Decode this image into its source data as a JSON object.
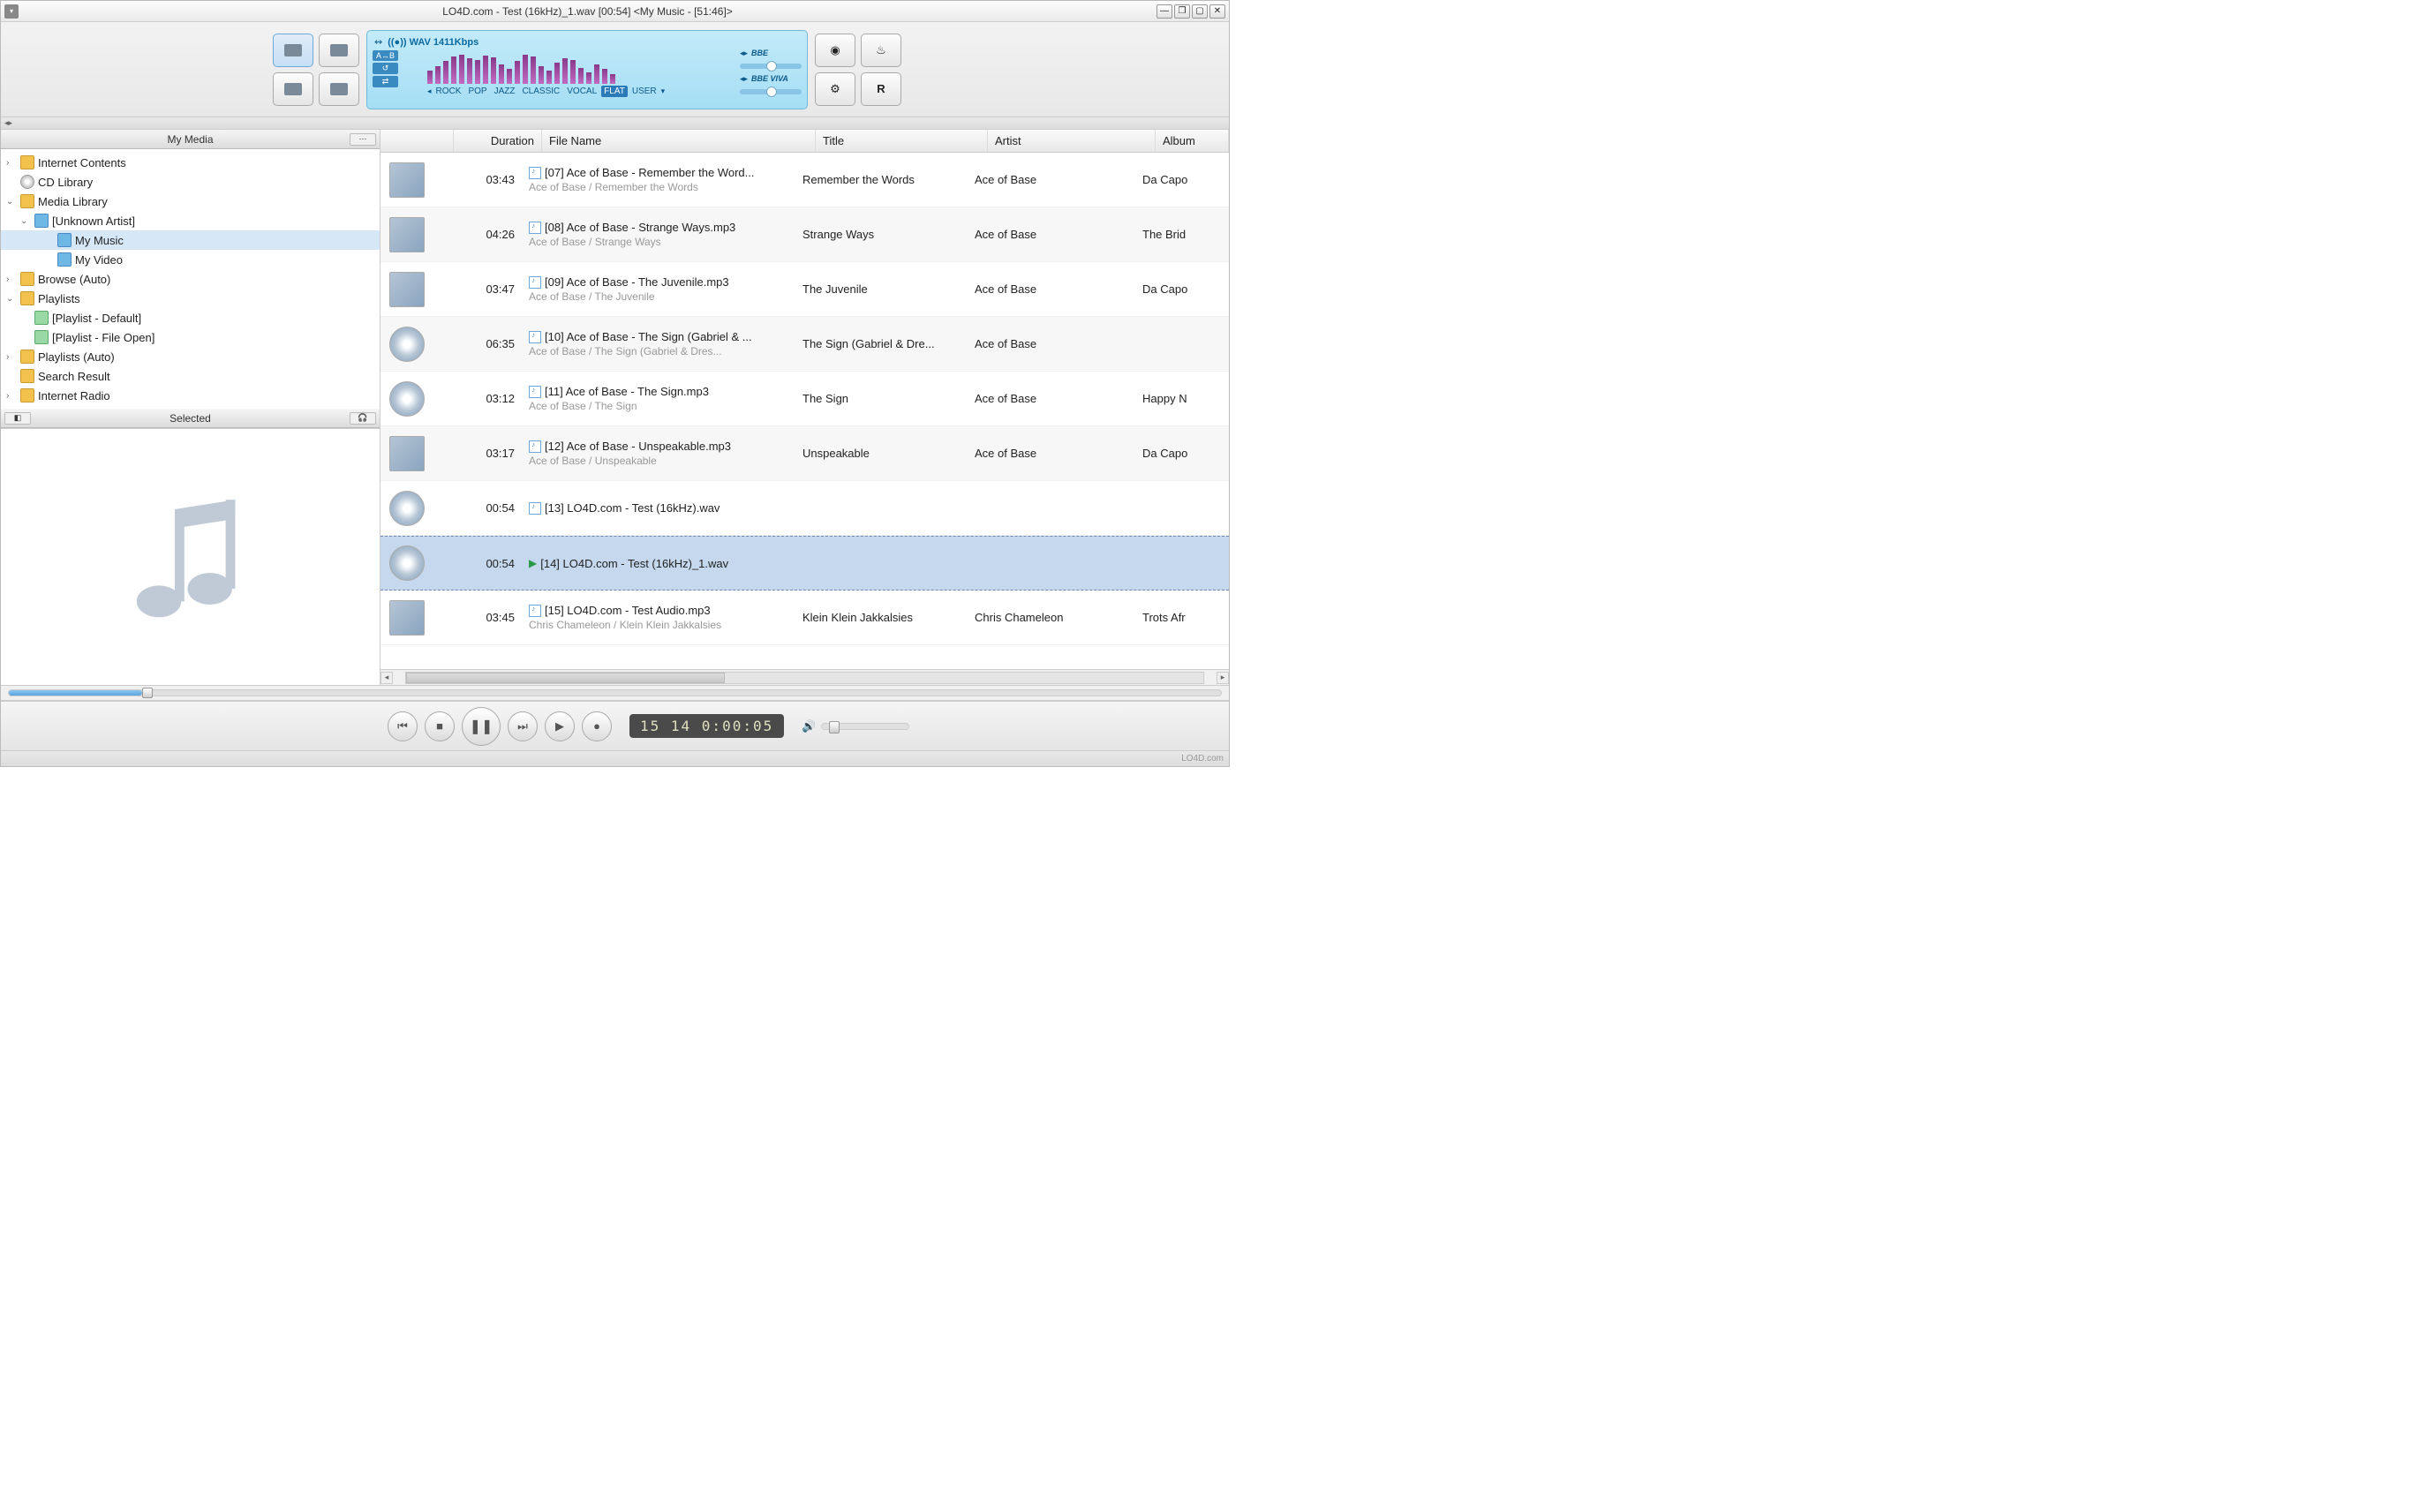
{
  "titlebar": {
    "text": "LO4D.com - Test (16kHz)_1.wav   [00:54]    <My Music - [51:46]>"
  },
  "equalizer": {
    "format": "((●)) WAV 1411Kbps",
    "chips": [
      "A↔B",
      "↺",
      "⇄"
    ],
    "presets": [
      "ROCK",
      "POP",
      "JAZZ",
      "CLASSIC",
      "VOCAL",
      "FLAT",
      "USER"
    ],
    "active_preset": "FLAT",
    "right_labels": [
      "BBE",
      "BBE VIVA"
    ]
  },
  "sidebar": {
    "header": "My Media",
    "selected_header": "Selected",
    "tree": [
      {
        "label": "Internet Contents",
        "depth": 0,
        "twisty": "›",
        "icon": "y"
      },
      {
        "label": "CD Library",
        "depth": 0,
        "twisty": "",
        "icon": "cd"
      },
      {
        "label": "Media Library",
        "depth": 0,
        "twisty": "⌄",
        "icon": "y"
      },
      {
        "label": "[Unknown Artist]",
        "depth": 1,
        "twisty": "⌄",
        "icon": "b"
      },
      {
        "label": "My Music",
        "depth": 2,
        "twisty": "",
        "icon": "b",
        "sel": true
      },
      {
        "label": "My Video",
        "depth": 2,
        "twisty": "",
        "icon": "b"
      },
      {
        "label": "Browse (Auto)",
        "depth": 0,
        "twisty": "›",
        "icon": "y"
      },
      {
        "label": "Playlists",
        "depth": 0,
        "twisty": "⌄",
        "icon": "y"
      },
      {
        "label": "[Playlist - Default]",
        "depth": 1,
        "twisty": "",
        "icon": "pl"
      },
      {
        "label": "[Playlist - File Open]",
        "depth": 1,
        "twisty": "",
        "icon": "pl"
      },
      {
        "label": "Playlists (Auto)",
        "depth": 0,
        "twisty": "›",
        "icon": "y"
      },
      {
        "label": "Search Result",
        "depth": 0,
        "twisty": "",
        "icon": "y"
      },
      {
        "label": "Internet Radio",
        "depth": 0,
        "twisty": "›",
        "icon": "y"
      }
    ]
  },
  "grid": {
    "headers": {
      "duration": "Duration",
      "filename": "File Name",
      "title": "Title",
      "artist": "Artist",
      "album": "Album"
    },
    "rows": [
      {
        "dur": "03:43",
        "fn": "[07] Ace of Base - Remember the Word...",
        "sub": "Ace of Base / Remember the Words",
        "ti": "Remember the Words",
        "ar": "Ace of Base",
        "al": "Da Capo",
        "thumb": "img"
      },
      {
        "dur": "04:26",
        "fn": "[08] Ace of Base - Strange Ways.mp3",
        "sub": "Ace of Base / Strange Ways",
        "ti": "Strange Ways",
        "ar": "Ace of Base",
        "al": "The Brid",
        "thumb": "img",
        "alt": true
      },
      {
        "dur": "03:47",
        "fn": "[09] Ace of Base - The Juvenile.mp3",
        "sub": "Ace of Base / The Juvenile",
        "ti": "The Juvenile",
        "ar": "Ace of Base",
        "al": "Da Capo",
        "thumb": "img"
      },
      {
        "dur": "06:35",
        "fn": "[10] Ace of Base - The Sign (Gabriel & ...",
        "sub": "Ace of Base / The Sign (Gabriel & Dres...",
        "ti": "The Sign (Gabriel & Dre...",
        "ar": "Ace of Base",
        "al": "",
        "thumb": "cd",
        "alt": true
      },
      {
        "dur": "03:12",
        "fn": "[11] Ace of Base - The Sign.mp3",
        "sub": "Ace of Base / The Sign",
        "ti": "The Sign",
        "ar": "Ace of Base",
        "al": "Happy N",
        "thumb": "cd"
      },
      {
        "dur": "03:17",
        "fn": "[12] Ace of Base - Unspeakable.mp3",
        "sub": "Ace of Base / Unspeakable",
        "ti": "Unspeakable",
        "ar": "Ace of Base",
        "al": "Da Capo",
        "thumb": "img",
        "alt": true
      },
      {
        "dur": "00:54",
        "fn": "[13] LO4D.com - Test (16kHz).wav",
        "sub": "",
        "ti": "",
        "ar": "",
        "al": "",
        "thumb": "cd"
      },
      {
        "dur": "00:54",
        "fn": "[14] LO4D.com - Test (16kHz)_1.wav",
        "sub": "",
        "ti": "",
        "ar": "",
        "al": "",
        "thumb": "cd",
        "playing": true
      },
      {
        "dur": "03:45",
        "fn": "[15] LO4D.com - Test Audio.mp3",
        "sub": "Chris Chameleon / Klein Klein Jakkalsies",
        "ti": "Klein Klein Jakkalsies",
        "ar": "Chris Chameleon",
        "al": "Trots Afr",
        "thumb": "img"
      }
    ]
  },
  "playback": {
    "time_display": "15   14   0:00:05"
  },
  "status": {
    "watermark": "LO4D.com"
  }
}
